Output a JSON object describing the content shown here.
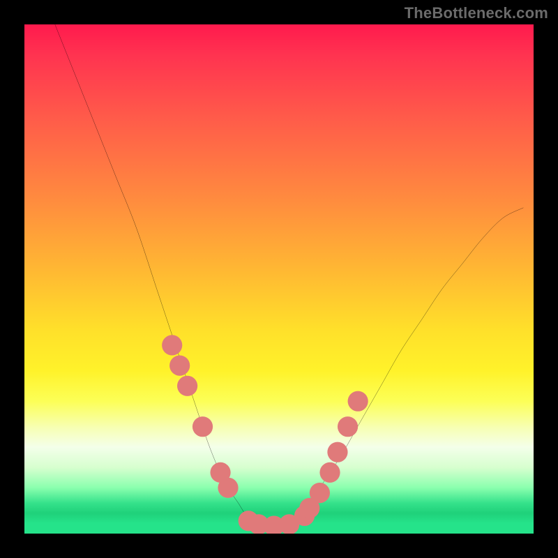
{
  "watermark": {
    "text": "TheBottleneck.com"
  },
  "chart_data": {
    "type": "line",
    "title": "",
    "xlabel": "",
    "ylabel": "",
    "xlim": [
      0,
      100
    ],
    "ylim": [
      0,
      100
    ],
    "grid": false,
    "legend": false,
    "series": [
      {
        "name": "bottleneck-curve",
        "x": [
          6,
          10,
          14,
          18,
          22,
          26,
          28,
          30,
          32,
          34,
          36,
          38,
          40,
          42,
          44,
          46,
          48,
          50,
          52,
          54,
          56,
          58,
          62,
          66,
          70,
          74,
          78,
          82,
          86,
          90,
          94,
          98
        ],
        "y": [
          100,
          90,
          80,
          70,
          60,
          48,
          42,
          36,
          30,
          24,
          18,
          13,
          9,
          6,
          3,
          2,
          1.5,
          1.5,
          2,
          3.5,
          6,
          9,
          15,
          22,
          29,
          36,
          42,
          48,
          53,
          58,
          62,
          64
        ]
      }
    ],
    "markers": {
      "name": "highlight-points",
      "x": [
        29,
        30.5,
        32,
        35,
        38.5,
        40,
        44,
        46,
        49,
        52,
        55,
        56,
        58,
        60,
        61.5,
        63.5,
        65.5
      ],
      "y": [
        37,
        33,
        29,
        21,
        12,
        9,
        2.5,
        1.8,
        1.5,
        1.8,
        3.5,
        5,
        8,
        12,
        16,
        21,
        26
      ],
      "color": "#e07a7a",
      "radius": 2.0
    },
    "background": {
      "type": "vertical-gradient",
      "stops": [
        {
          "pct": 0,
          "color": "#ff1a4d"
        },
        {
          "pct": 18,
          "color": "#ff5a4a"
        },
        {
          "pct": 48,
          "color": "#ffb733"
        },
        {
          "pct": 68,
          "color": "#fff22a"
        },
        {
          "pct": 83,
          "color": "#f4ffea"
        },
        {
          "pct": 94,
          "color": "#35e28b"
        },
        {
          "pct": 100,
          "color": "#25e38a"
        }
      ]
    }
  }
}
